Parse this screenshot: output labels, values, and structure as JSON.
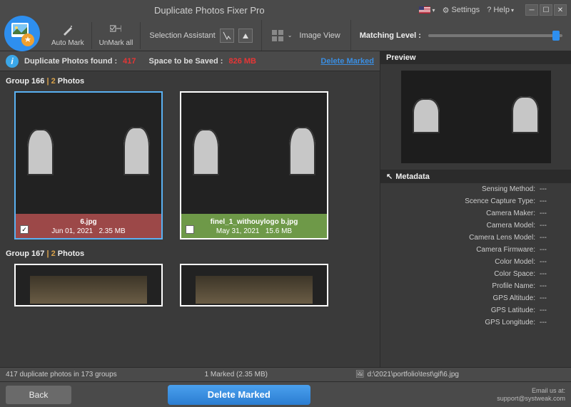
{
  "title": "Duplicate Photos Fixer Pro",
  "titlebar": {
    "settings": "Settings",
    "help": "? Help",
    "flag": "us-flag-icon"
  },
  "toolbar": {
    "automark": "Auto Mark",
    "unmarkall": "UnMark all",
    "selassist": "Selection Assistant",
    "imageview": "Image View",
    "matchlevel": "Matching Level :"
  },
  "stats": {
    "found_label": "Duplicate Photos found :",
    "found_value": "417",
    "space_label": "Space to be Saved :",
    "space_value": "826 MB",
    "delete_marked": "Delete Marked"
  },
  "groups": [
    {
      "name": "Group 166",
      "divider": "|",
      "count": "2",
      "photos_word": "Photos",
      "items": [
        {
          "filename": "6.jpg",
          "date": "Jun 01, 2021",
          "size": "2.35 MB",
          "selected": true,
          "checked": true,
          "theme": "red"
        },
        {
          "filename": "finel_1_withouylogo b.jpg",
          "date": "May 31, 2021",
          "size": "15.6 MB",
          "selected": false,
          "checked": false,
          "theme": "grn"
        }
      ]
    },
    {
      "name": "Group 167",
      "divider": "|",
      "count": "2",
      "photos_word": "Photos",
      "items": [
        {
          "filename": "",
          "date": "",
          "size": "",
          "selected": false,
          "checked": false,
          "theme": "none"
        },
        {
          "filename": "",
          "date": "",
          "size": "",
          "selected": false,
          "checked": false,
          "theme": "none"
        }
      ]
    }
  ],
  "right": {
    "preview": "Preview",
    "metadata_hdr": "Metadata",
    "rows": [
      {
        "k": "Sensing Method:",
        "v": "---"
      },
      {
        "k": "Scence Capture Type:",
        "v": "---"
      },
      {
        "k": "Camera Maker:",
        "v": "---"
      },
      {
        "k": "Camera Model:",
        "v": "---"
      },
      {
        "k": "Camera Lens Model:",
        "v": "---"
      },
      {
        "k": "Camera Firmware:",
        "v": "---"
      },
      {
        "k": "Color Model:",
        "v": "---"
      },
      {
        "k": "Color Space:",
        "v": "---"
      },
      {
        "k": "Profile Name:",
        "v": "---"
      },
      {
        "k": "GPS Altitude:",
        "v": "---"
      },
      {
        "k": "GPS Latitude:",
        "v": "---"
      },
      {
        "k": "GPS Longitude:",
        "v": "---"
      }
    ]
  },
  "status": {
    "left": "417 duplicate photos in 173 groups",
    "mid": "1 Marked (2.35 MB)",
    "path": "d:\\2021\\portfolio\\test\\gif\\6.jpg"
  },
  "footer": {
    "back": "Back",
    "delete": "Delete Marked",
    "email_lbl": "Email us at:",
    "email": "support@systweak.com"
  }
}
